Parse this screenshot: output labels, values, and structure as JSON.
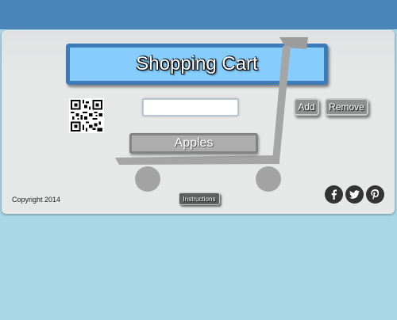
{
  "app": {
    "title": "Shopping Cart"
  },
  "form": {
    "item_input_value": "",
    "item_input_placeholder": "",
    "add_label": "Add",
    "remove_label": "Remove"
  },
  "list": {
    "items": [
      {
        "label": "Apples"
      }
    ]
  },
  "footer": {
    "copyright": "Copyright 2014",
    "instructions_label": "Instructions",
    "social": [
      {
        "icon": "facebook-icon"
      },
      {
        "icon": "twitter-icon"
      },
      {
        "icon": "pinterest-icon"
      }
    ]
  },
  "colors": {
    "header_bar": "#4a84b8",
    "title_fill": "#87cdfb",
    "title_border": "#3d7ab8",
    "card": "#e6e7e7",
    "page_bg": "#a9d7e6",
    "button": "#8e8f8f",
    "social": "#333333"
  }
}
